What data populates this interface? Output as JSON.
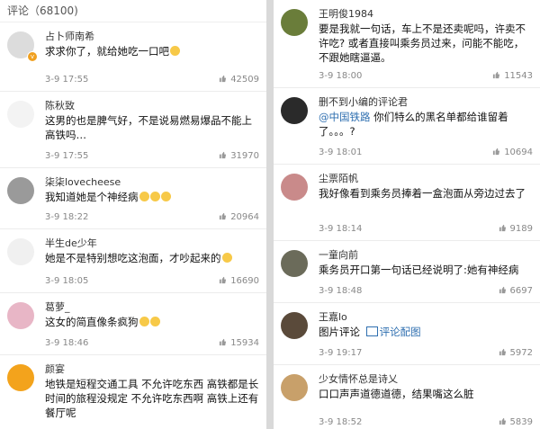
{
  "header": {
    "title": "评论（68100)"
  },
  "left": [
    {
      "name": "占卜师南希",
      "text": "求求你了，就给她吃一口吧",
      "emoji": true,
      "time": "3-9 17:55",
      "likes": "42509",
      "verified": true,
      "avatar_color": "#dcdcdc",
      "h": 76
    },
    {
      "name": "陈秋致",
      "text": "这男的也是脾气好，不是说易燃易爆品不能上高铁吗…",
      "time": "3-9 17:55",
      "likes": "31970",
      "avatar_color": "#f3f3f3",
      "h": 84
    },
    {
      "name": "柒柒lovecheese",
      "text": "我知道她是个神经病",
      "emoji3": true,
      "time": "3-9 18:22",
      "likes": "20964",
      "avatar_color": "#9a9a9a",
      "h": 67
    },
    {
      "name": "半生de少年",
      "text": "她是不是特别想吃这泡面，才吵起来的",
      "emoji": true,
      "time": "3-9 18:05",
      "likes": "16690",
      "avatar_color": "#f0f0f0",
      "h": 70
    },
    {
      "name": "葛萝_",
      "text": "这女的简直像条疯狗",
      "emoji2": true,
      "time": "3-9 18:46",
      "likes": "15934",
      "avatar_color": "#e8b6c6",
      "h": 68
    },
    {
      "name": "颜宴",
      "text": "地铁是短程交通工具 不允许吃东西 高铁都是长时间的旅程没规定 不允许吃东西啊 高铁上还有餐厅呢",
      "time": "",
      "likes": "",
      "avatar_color": "#f3a31c",
      "h": 88
    }
  ],
  "right": [
    {
      "name": "王明俊1984",
      "text": "要是我就一句话，车上不是还卖呢吗，许卖不许吃? 或者直接叫乘务员过来，问能不能吃，不跟她瞎逼逼。",
      "time": "3-9 18:00",
      "likes": "11543",
      "avatar_color": "#6a7d3a",
      "h": 97
    },
    {
      "name": "删不到小编的评论君",
      "at": "@中国铁路",
      "text": " 你们特么的黑名单都给谁留着了。。。?",
      "time": "3-9 18:01",
      "likes": "10694",
      "avatar_color": "#2a2a2a",
      "h": 84
    },
    {
      "name": "尘票陌帆",
      "text": "我好像看到乘务员捧着一盒泡面从旁边过去了",
      "time": "3-9 18:14",
      "likes": "9189",
      "avatar_color": "#c98a8a",
      "h": 84
    },
    {
      "name": "一童向前",
      "text": "乘务员开口第一句话已经说明了:她有神经病",
      "time": "3-9 18:48",
      "likes": "6697",
      "avatar_color": "#6b6b5a",
      "h": 68
    },
    {
      "name": "王嘉lo",
      "text": "图片评论 ",
      "link": "评论配图",
      "time": "3-9 19:17",
      "likes": "5972",
      "avatar_color": "#5a4a3a",
      "h": 68
    },
    {
      "name": "少女情怀总是诗乂",
      "text": "口口声声道德道德，结果嘴这么脏",
      "time": "3-9 18:52",
      "likes": "5839",
      "avatar_color": "#c8a06a",
      "h": 76
    }
  ]
}
